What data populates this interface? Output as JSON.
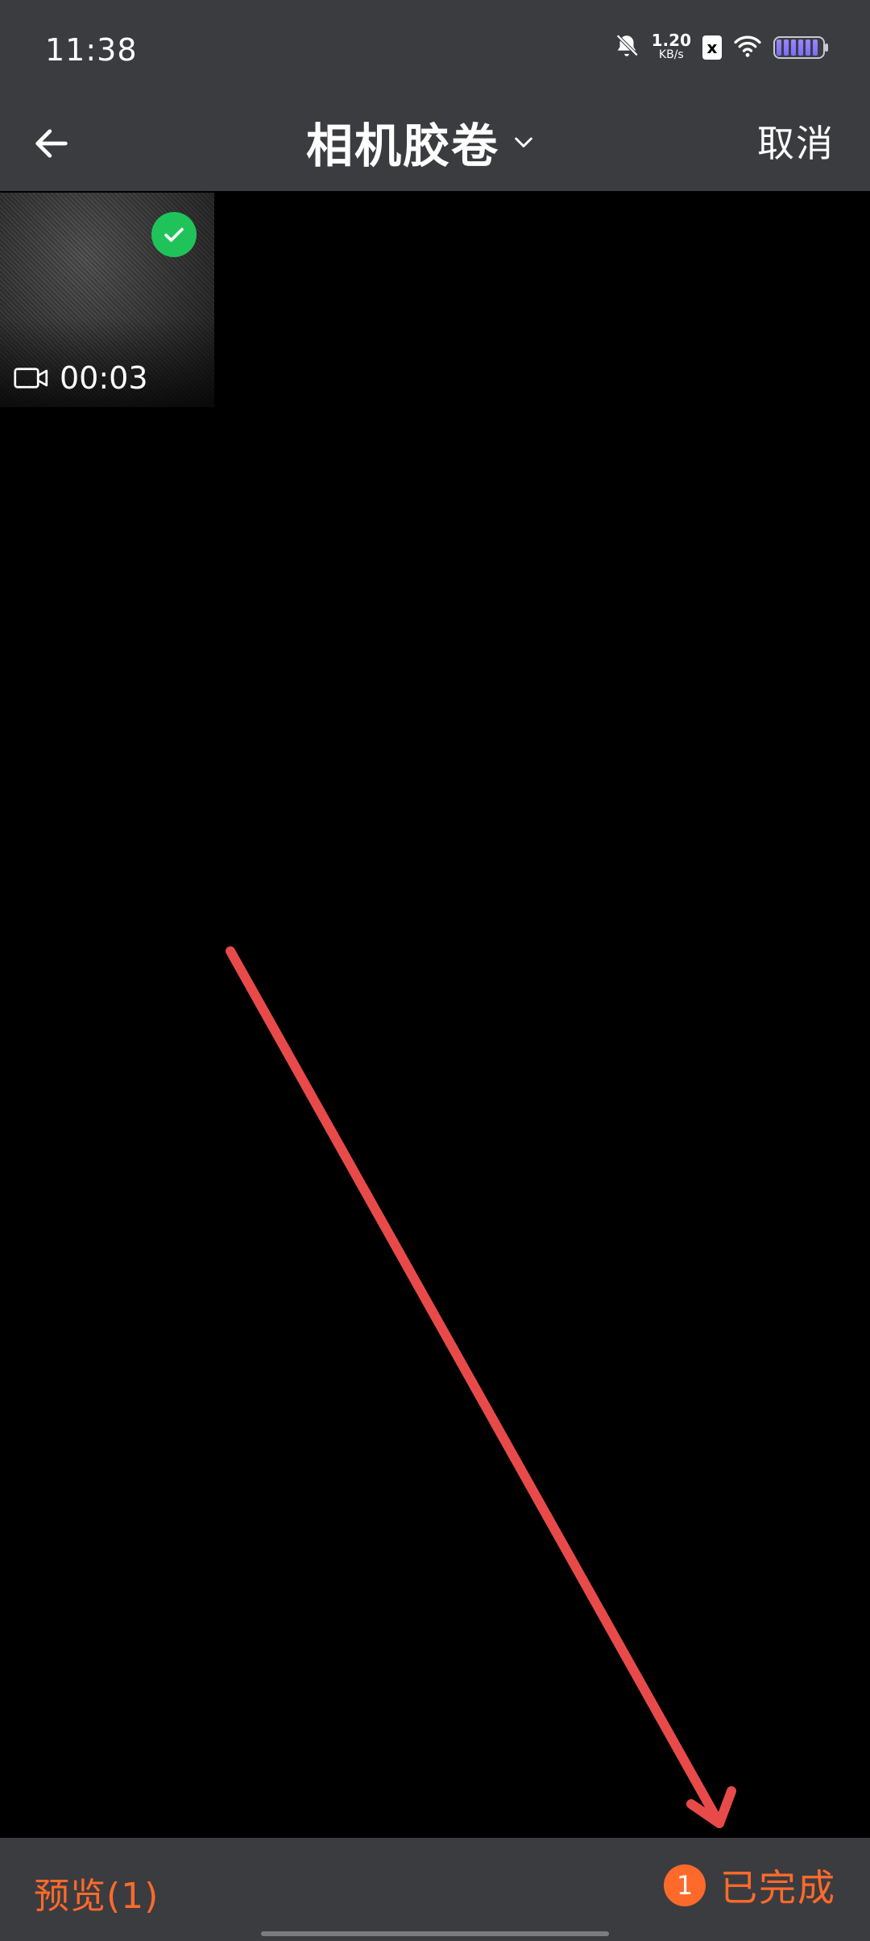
{
  "status_bar": {
    "time": "11:38",
    "net_speed_value": "1.20",
    "net_speed_unit": "KB/s",
    "badge_letter": "x"
  },
  "app_bar": {
    "title": "相机胶卷",
    "cancel_label": "取消"
  },
  "grid": {
    "items": [
      {
        "type": "video",
        "duration": "00:03",
        "selected": true
      }
    ]
  },
  "bottom_bar": {
    "preview_label": "预览(1)",
    "selected_count": "1",
    "done_label": "已完成"
  },
  "colors": {
    "bar_bg": "#3b3c40",
    "accent": "#ff6a2a",
    "check": "#1fc35a",
    "annotation_arrow": "#e84a4a"
  },
  "icons": {
    "back": "arrow-left-icon",
    "dropdown": "chevron-down-icon",
    "selected": "check-icon",
    "video": "video-camera-icon",
    "mute": "bell-off-icon",
    "wifi": "wifi-icon",
    "battery": "battery-icon"
  }
}
